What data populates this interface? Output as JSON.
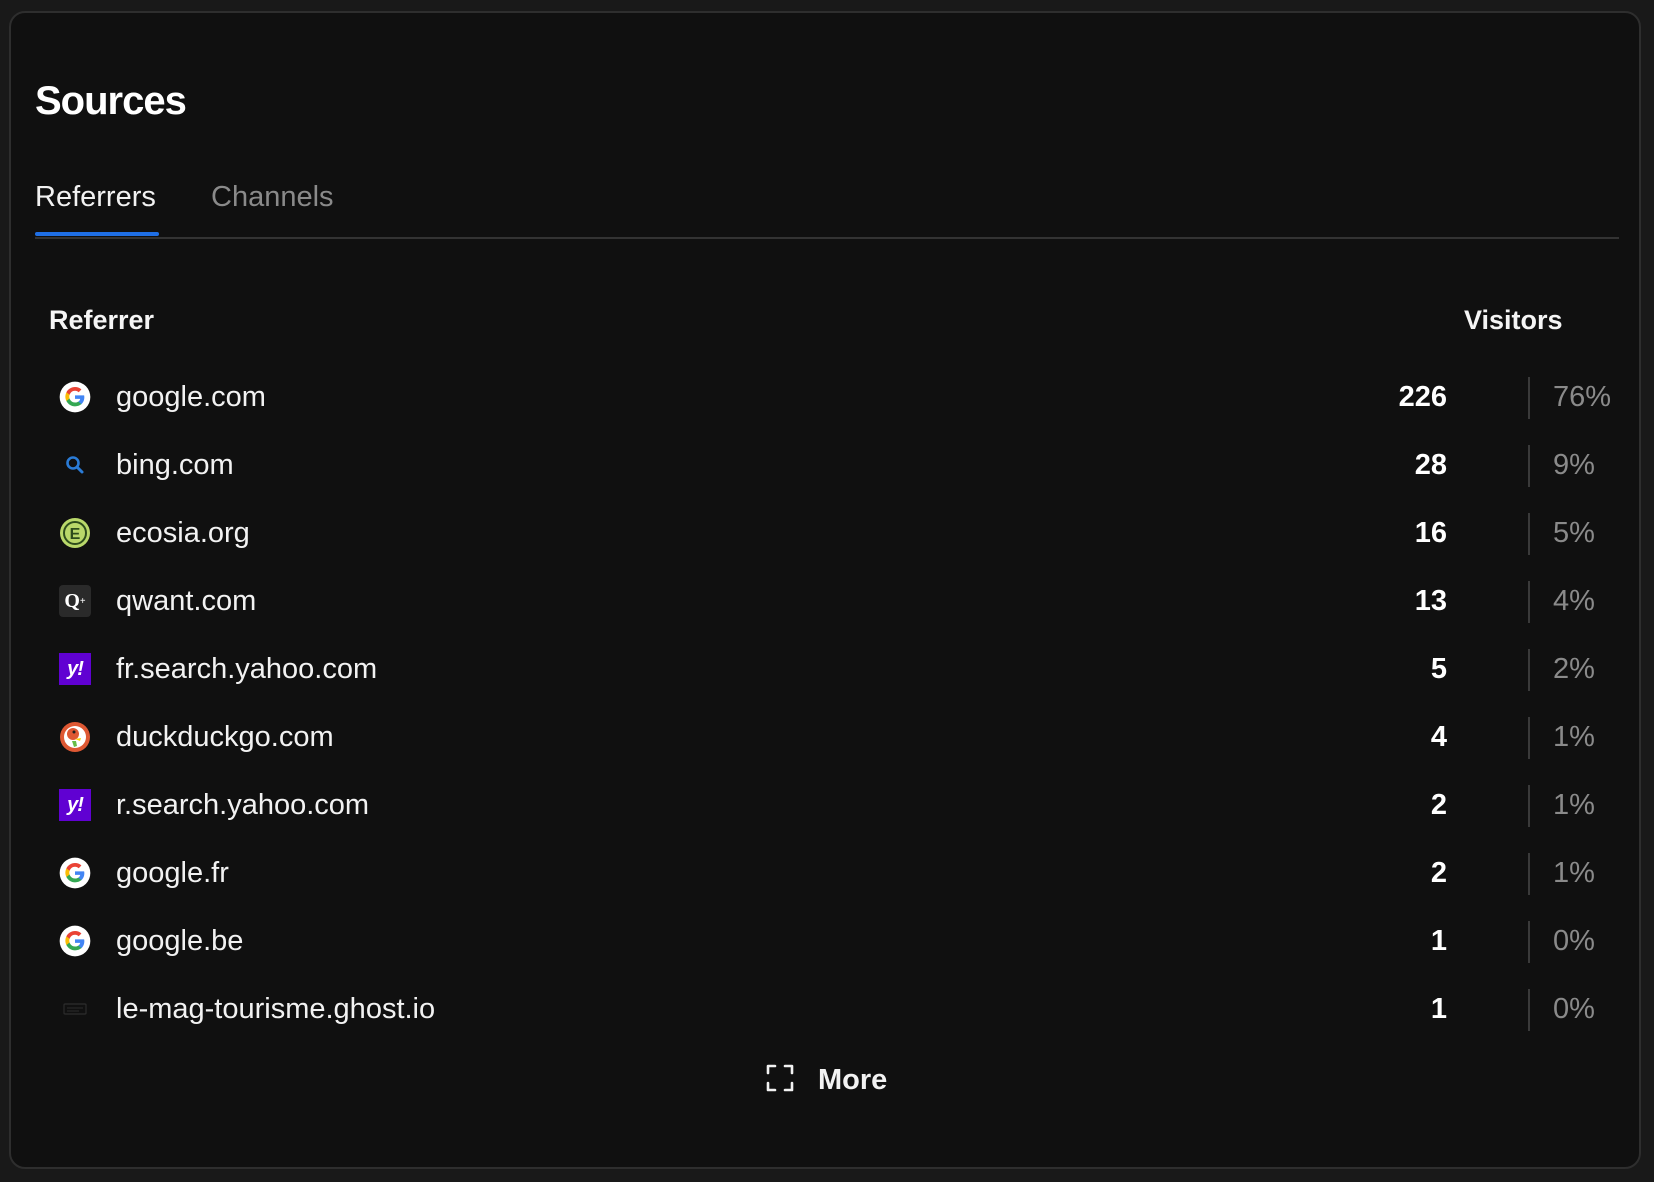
{
  "panel": {
    "title": "Sources",
    "tabs": [
      {
        "label": "Referrers",
        "active": true
      },
      {
        "label": "Channels",
        "active": false
      }
    ]
  },
  "table": {
    "headers": {
      "referrer": "Referrer",
      "visitors": "Visitors"
    },
    "rows": [
      {
        "icon": "google-icon",
        "name": "google.com",
        "visitors": "226",
        "percent": "76%"
      },
      {
        "icon": "bing-search-icon",
        "name": "bing.com",
        "visitors": "28",
        "percent": "9%"
      },
      {
        "icon": "ecosia-icon",
        "name": "ecosia.org",
        "visitors": "16",
        "percent": "5%"
      },
      {
        "icon": "qwant-icon",
        "name": "qwant.com",
        "visitors": "13",
        "percent": "4%"
      },
      {
        "icon": "yahoo-icon",
        "name": "fr.search.yahoo.com",
        "visitors": "5",
        "percent": "2%"
      },
      {
        "icon": "duckduckgo-icon",
        "name": "duckduckgo.com",
        "visitors": "4",
        "percent": "1%"
      },
      {
        "icon": "yahoo-icon",
        "name": "r.search.yahoo.com",
        "visitors": "2",
        "percent": "1%"
      },
      {
        "icon": "google-icon",
        "name": "google.fr",
        "visitors": "2",
        "percent": "1%"
      },
      {
        "icon": "google-icon",
        "name": "google.be",
        "visitors": "1",
        "percent": "0%"
      },
      {
        "icon": "ghost-site-icon",
        "name": "le-mag-tourisme.ghost.io",
        "visitors": "1",
        "percent": "0%"
      }
    ]
  },
  "more_button": {
    "label": "More",
    "icon": "expand-icon"
  },
  "colors": {
    "background": "#101010",
    "tab_accent": "#1f6fe5",
    "muted_text": "#8a8a8a",
    "yahoo_purple": "#6001d2"
  }
}
